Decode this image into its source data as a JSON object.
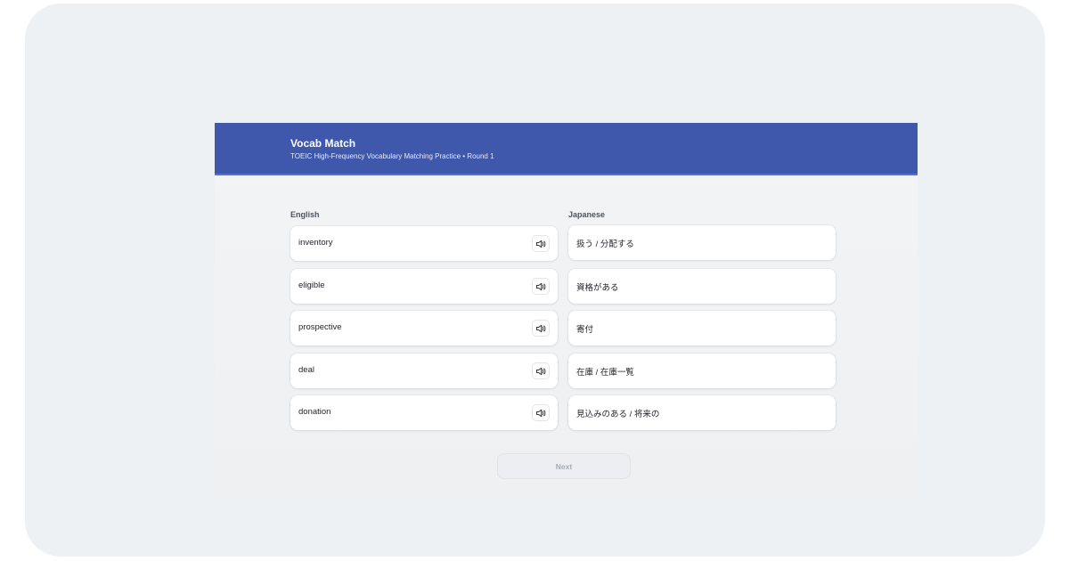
{
  "header": {
    "title": "Vocab Match",
    "subtitle": "TOEIC High-Frequency Vocabulary Matching Practice • Round 1"
  },
  "columns": {
    "english_label": "English",
    "japanese_label": "Japanese"
  },
  "english_words": [
    {
      "text": "inventory",
      "icon": "speaker-icon"
    },
    {
      "text": "eligible",
      "icon": "speaker-icon"
    },
    {
      "text": "prospective",
      "icon": "speaker-icon"
    },
    {
      "text": "deal",
      "icon": "speaker-icon"
    },
    {
      "text": "donation",
      "icon": "speaker-icon"
    }
  ],
  "japanese_words": [
    {
      "text": "扱う / 分配する"
    },
    {
      "text": "資格がある"
    },
    {
      "text": "寄付"
    },
    {
      "text": "在庫 / 在庫一覧"
    },
    {
      "text": "見込みのある / 将来の"
    }
  ],
  "footer": {
    "next_label": "Next"
  },
  "colors": {
    "header_bg": "#3f58ab",
    "page_bg": "#eef1f3"
  }
}
